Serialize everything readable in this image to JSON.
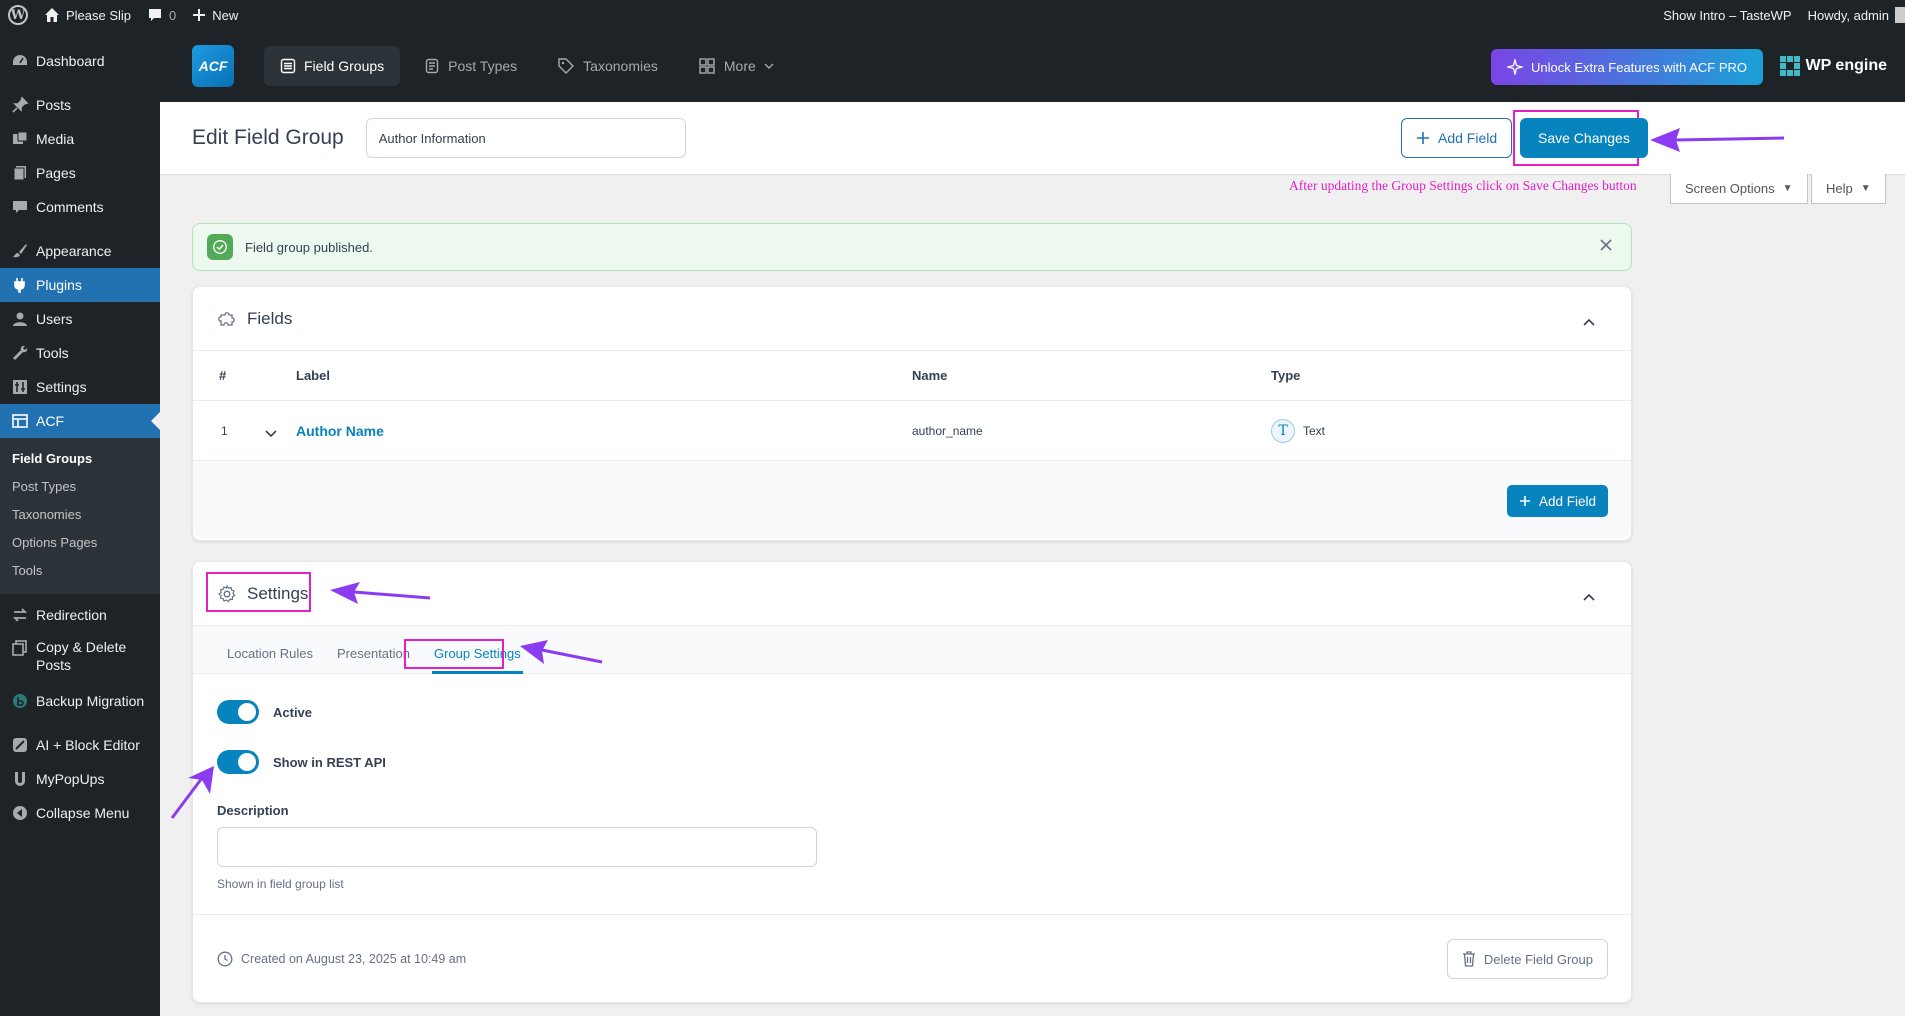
{
  "adminbar": {
    "site_name": "Please Slip",
    "comments_count": "0",
    "new_label": "New",
    "show_intro": "Show Intro – TasteWP",
    "howdy": "Howdy, admin"
  },
  "sidebar": {
    "items": [
      {
        "label": "Dashboard"
      },
      {
        "label": "Posts"
      },
      {
        "label": "Media"
      },
      {
        "label": "Pages"
      },
      {
        "label": "Comments"
      },
      {
        "label": "Appearance"
      },
      {
        "label": "Plugins"
      },
      {
        "label": "Users"
      },
      {
        "label": "Tools"
      },
      {
        "label": "Settings"
      },
      {
        "label": "ACF"
      }
    ],
    "acf_submenu": [
      "Field Groups",
      "Post Types",
      "Taxonomies",
      "Options Pages",
      "Tools"
    ],
    "after_items": [
      {
        "label": "Redirection"
      },
      {
        "label": "Copy & Delete Posts"
      },
      {
        "label": "Backup Migration"
      },
      {
        "label": "AI + Block Editor"
      },
      {
        "label": "MyPopUps"
      },
      {
        "label": "Collapse Menu"
      }
    ]
  },
  "acf_header": {
    "logo": "ACF",
    "tabs": [
      "Field Groups",
      "Post Types",
      "Taxonomies",
      "More"
    ],
    "unlock": "Unlock Extra Features with ACF PRO",
    "wpengine": "WP engine"
  },
  "headerbar": {
    "title": "Edit Field Group",
    "group_name": "Author Information",
    "add_field": "Add Field",
    "save": "Save Changes"
  },
  "annotation_text": "After updating the Group Settings click on Save Changes button",
  "screen_options": "Screen Options",
  "help": "Help",
  "notice": "Field group published.",
  "fields": {
    "title": "Fields",
    "columns": [
      "#",
      "Label",
      "Name",
      "Type"
    ],
    "rows": [
      {
        "num": "1",
        "label": "Author Name",
        "name": "author_name",
        "type": "Text"
      }
    ],
    "add_field": "Add Field"
  },
  "settings": {
    "title": "Settings",
    "tabs": [
      "Location Rules",
      "Presentation",
      "Group Settings"
    ],
    "active_label": "Active",
    "active_on": true,
    "rest_label": "Show in REST API",
    "rest_on": true,
    "description_label": "Description",
    "description_value": "",
    "description_help": "Shown in field group list",
    "created": "Created on August 23, 2025 at 10:49 am",
    "delete": "Delete Field Group"
  },
  "colors": {
    "wp_blue": "#2271b1",
    "acf_blue": "#0783be",
    "highlight": "#e020c8",
    "arrow": "#8b3cf0"
  }
}
